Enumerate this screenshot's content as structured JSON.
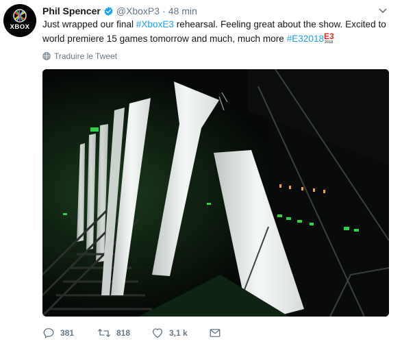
{
  "tweet": {
    "author_name": "Phil Spencer",
    "author_handle": "@XboxP3",
    "separator": "·",
    "time": "48 min",
    "avatar_text": "XBOX",
    "text_before": "Just wrapped our final ",
    "hashtag_1": "#XboxE3",
    "text_middle": " rehearsal. Feeling great about the show. Excited to world premiere 15 games tomorrow and much, much more ",
    "hashtag_2": "#E32018",
    "e3_badge_text": "E3",
    "e3_badge_year": "2018",
    "translate_label": "Traduire le Tweet"
  },
  "actions": {
    "replies": "381",
    "retweets": "818",
    "likes": "3,1 k"
  },
  "colors": {
    "link": "#1da1f2",
    "secondary": "#657786",
    "verified": "#1da1f2",
    "xbox_green": "#107c10"
  },
  "icons": [
    "xbox-logo-icon",
    "verified-badge-icon",
    "chevron-down-icon",
    "globe-icon",
    "reply-icon",
    "retweet-icon",
    "heart-icon",
    "message-icon"
  ]
}
